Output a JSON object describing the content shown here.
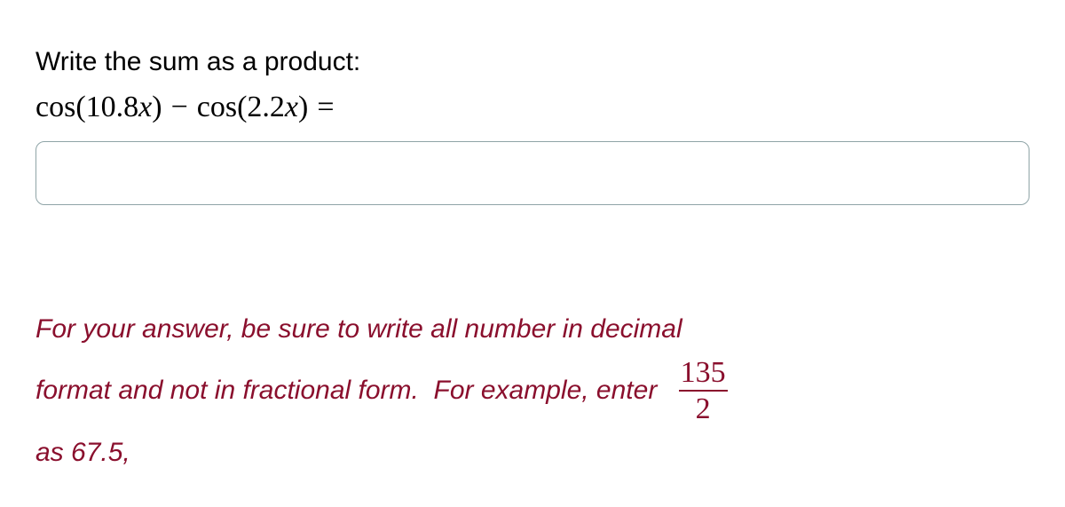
{
  "prompt": {
    "instruction": "Write the sum as a product:",
    "equation": {
      "fn1": "cos",
      "arg1_open": "(",
      "arg1_coef": "10.8",
      "arg1_var": "x",
      "arg1_close": ")",
      "op_minus": "−",
      "fn2": "cos",
      "arg2_open": "(",
      "arg2_coef": "2.2",
      "arg2_var": "x",
      "arg2_close": ")",
      "op_eq": "="
    }
  },
  "input": {
    "value": "",
    "placeholder": ""
  },
  "hint": {
    "line1": "For your answer, be sure to write all number in decimal",
    "line2_pre": "format and not in fractional form.  For example, enter ",
    "frac_num": "135",
    "frac_den": "2",
    "line3": "as 67.5,"
  }
}
